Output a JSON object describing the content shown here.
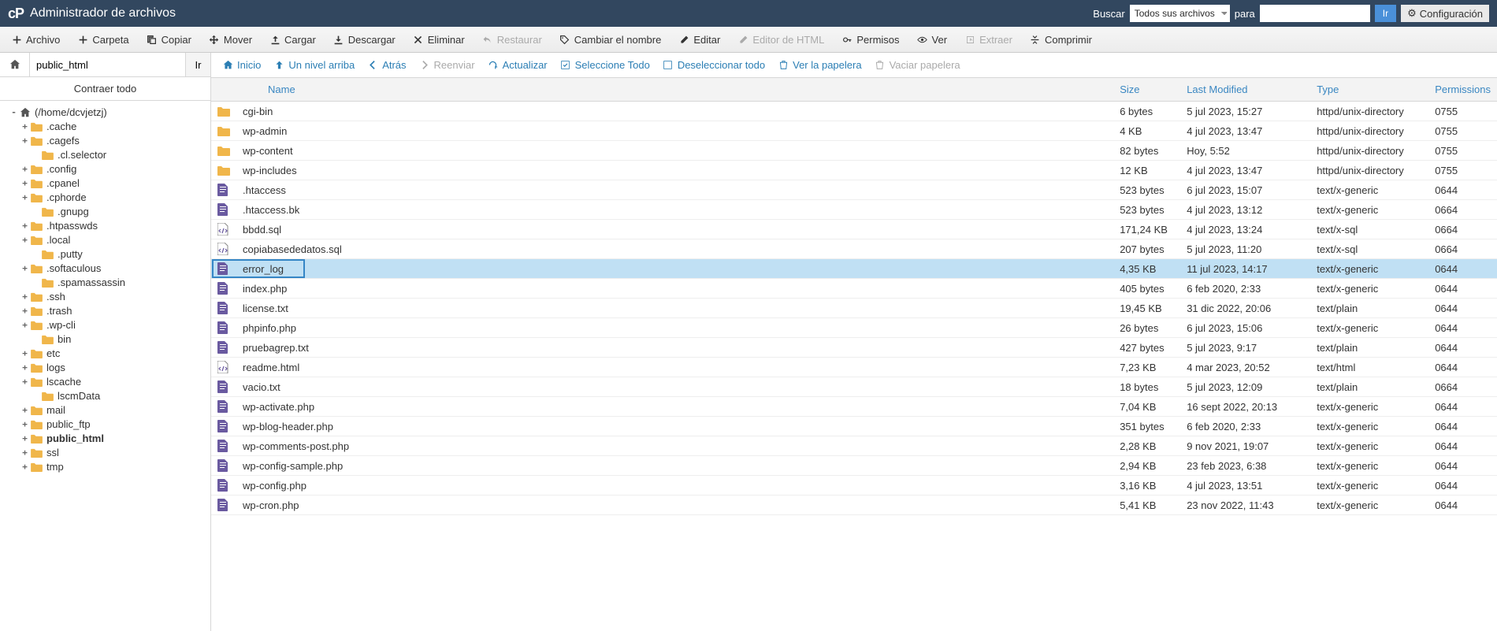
{
  "header": {
    "title": "Administrador de archivos",
    "search_label": "Buscar",
    "scope_selected": "Todos sus archivos",
    "for_label": "para",
    "search_value": "",
    "go_label": "Ir",
    "settings_label": "Configuración"
  },
  "toolbar": [
    {
      "id": "file",
      "label": "Archivo",
      "icon": "plus",
      "disabled": false
    },
    {
      "id": "folder",
      "label": "Carpeta",
      "icon": "plus",
      "disabled": false
    },
    {
      "id": "copy",
      "label": "Copiar",
      "icon": "copy",
      "disabled": false
    },
    {
      "id": "move",
      "label": "Mover",
      "icon": "move",
      "disabled": false
    },
    {
      "id": "upload",
      "label": "Cargar",
      "icon": "upload",
      "disabled": false
    },
    {
      "id": "download",
      "label": "Descargar",
      "icon": "download",
      "disabled": false
    },
    {
      "id": "delete",
      "label": "Eliminar",
      "icon": "x",
      "disabled": false
    },
    {
      "id": "restore",
      "label": "Restaurar",
      "icon": "undo",
      "disabled": true
    },
    {
      "id": "rename",
      "label": "Cambiar el nombre",
      "icon": "tag",
      "disabled": false
    },
    {
      "id": "edit",
      "label": "Editar",
      "icon": "pencil",
      "disabled": false
    },
    {
      "id": "htmleditor",
      "label": "Editor de HTML",
      "icon": "pencil",
      "disabled": true
    },
    {
      "id": "perms",
      "label": "Permisos",
      "icon": "key",
      "disabled": false
    },
    {
      "id": "view",
      "label": "Ver",
      "icon": "eye",
      "disabled": false
    },
    {
      "id": "extract",
      "label": "Extraer",
      "icon": "extract",
      "disabled": true
    },
    {
      "id": "compress",
      "label": "Comprimir",
      "icon": "compress",
      "disabled": false
    }
  ],
  "pathbar": {
    "value": "public_html",
    "go": "Ir"
  },
  "collapse_all": "Contraer todo",
  "tree": [
    {
      "depth": 0,
      "toggle": "-",
      "label": "(/home/dcvjetzj)",
      "icon": "home",
      "bold": false
    },
    {
      "depth": 1,
      "toggle": "+",
      "label": ".cache",
      "icon": "folder",
      "bold": false
    },
    {
      "depth": 1,
      "toggle": "+",
      "label": ".cagefs",
      "icon": "folder",
      "bold": false
    },
    {
      "depth": 2,
      "toggle": "",
      "label": ".cl.selector",
      "icon": "folder",
      "bold": false
    },
    {
      "depth": 1,
      "toggle": "+",
      "label": ".config",
      "icon": "folder",
      "bold": false
    },
    {
      "depth": 1,
      "toggle": "+",
      "label": ".cpanel",
      "icon": "folder",
      "bold": false
    },
    {
      "depth": 1,
      "toggle": "+",
      "label": ".cphorde",
      "icon": "folder",
      "bold": false
    },
    {
      "depth": 2,
      "toggle": "",
      "label": ".gnupg",
      "icon": "folder",
      "bold": false
    },
    {
      "depth": 1,
      "toggle": "+",
      "label": ".htpasswds",
      "icon": "folder",
      "bold": false
    },
    {
      "depth": 1,
      "toggle": "+",
      "label": ".local",
      "icon": "folder",
      "bold": false
    },
    {
      "depth": 2,
      "toggle": "",
      "label": ".putty",
      "icon": "folder",
      "bold": false
    },
    {
      "depth": 1,
      "toggle": "+",
      "label": ".softaculous",
      "icon": "folder",
      "bold": false
    },
    {
      "depth": 2,
      "toggle": "",
      "label": ".spamassassin",
      "icon": "folder",
      "bold": false
    },
    {
      "depth": 1,
      "toggle": "+",
      "label": ".ssh",
      "icon": "folder",
      "bold": false
    },
    {
      "depth": 1,
      "toggle": "+",
      "label": ".trash",
      "icon": "folder",
      "bold": false
    },
    {
      "depth": 1,
      "toggle": "+",
      "label": ".wp-cli",
      "icon": "folder",
      "bold": false
    },
    {
      "depth": 2,
      "toggle": "",
      "label": "bin",
      "icon": "folder",
      "bold": false
    },
    {
      "depth": 1,
      "toggle": "+",
      "label": "etc",
      "icon": "folder",
      "bold": false
    },
    {
      "depth": 1,
      "toggle": "+",
      "label": "logs",
      "icon": "folder",
      "bold": false
    },
    {
      "depth": 1,
      "toggle": "+",
      "label": "lscache",
      "icon": "folder",
      "bold": false
    },
    {
      "depth": 2,
      "toggle": "",
      "label": "lscmData",
      "icon": "folder",
      "bold": false
    },
    {
      "depth": 1,
      "toggle": "+",
      "label": "mail",
      "icon": "folder",
      "bold": false
    },
    {
      "depth": 1,
      "toggle": "+",
      "label": "public_ftp",
      "icon": "folder",
      "bold": false
    },
    {
      "depth": 1,
      "toggle": "+",
      "label": "public_html",
      "icon": "folder",
      "bold": true
    },
    {
      "depth": 1,
      "toggle": "+",
      "label": "ssl",
      "icon": "folder",
      "bold": false
    },
    {
      "depth": 1,
      "toggle": "+",
      "label": "tmp",
      "icon": "folder",
      "bold": false
    }
  ],
  "navbar": [
    {
      "id": "home",
      "label": "Inicio",
      "icon": "home",
      "disabled": false
    },
    {
      "id": "up",
      "label": "Un nivel arriba",
      "icon": "uparrow",
      "disabled": false
    },
    {
      "id": "back",
      "label": "Atrás",
      "icon": "left",
      "disabled": false
    },
    {
      "id": "fwd",
      "label": "Reenviar",
      "icon": "right",
      "disabled": true
    },
    {
      "id": "reload",
      "label": "Actualizar",
      "icon": "reload",
      "disabled": false
    },
    {
      "id": "selectall",
      "label": "Seleccione Todo",
      "icon": "check",
      "disabled": false
    },
    {
      "id": "deselect",
      "label": "Deseleccionar todo",
      "icon": "uncheck",
      "disabled": false
    },
    {
      "id": "trash",
      "label": "Ver la papelera",
      "icon": "trash",
      "disabled": false
    },
    {
      "id": "empty",
      "label": "Vaciar papelera",
      "icon": "trash",
      "disabled": true
    }
  ],
  "columns": {
    "name": "Name",
    "size": "Size",
    "modified": "Last Modified",
    "type": "Type",
    "perms": "Permissions"
  },
  "files": [
    {
      "icon": "folder",
      "name": "cgi-bin",
      "size": "6 bytes",
      "mod": "5 jul 2023, 15:27",
      "type": "httpd/unix-directory",
      "perm": "0755",
      "sel": false
    },
    {
      "icon": "folder",
      "name": "wp-admin",
      "size": "4 KB",
      "mod": "4 jul 2023, 13:47",
      "type": "httpd/unix-directory",
      "perm": "0755",
      "sel": false
    },
    {
      "icon": "folder",
      "name": "wp-content",
      "size": "82 bytes",
      "mod": "Hoy, 5:52",
      "type": "httpd/unix-directory",
      "perm": "0755",
      "sel": false
    },
    {
      "icon": "folder",
      "name": "wp-includes",
      "size": "12 KB",
      "mod": "4 jul 2023, 13:47",
      "type": "httpd/unix-directory",
      "perm": "0755",
      "sel": false
    },
    {
      "icon": "file",
      "name": ".htaccess",
      "size": "523 bytes",
      "mod": "6 jul 2023, 15:07",
      "type": "text/x-generic",
      "perm": "0644",
      "sel": false
    },
    {
      "icon": "file",
      "name": ".htaccess.bk",
      "size": "523 bytes",
      "mod": "4 jul 2023, 13:12",
      "type": "text/x-generic",
      "perm": "0664",
      "sel": false
    },
    {
      "icon": "code",
      "name": "bbdd.sql",
      "size": "171,24 KB",
      "mod": "4 jul 2023, 13:24",
      "type": "text/x-sql",
      "perm": "0664",
      "sel": false
    },
    {
      "icon": "code",
      "name": "copiabasededatos.sql",
      "size": "207 bytes",
      "mod": "5 jul 2023, 11:20",
      "type": "text/x-sql",
      "perm": "0664",
      "sel": false
    },
    {
      "icon": "file",
      "name": "error_log",
      "size": "4,35 KB",
      "mod": "11 jul 2023, 14:17",
      "type": "text/x-generic",
      "perm": "0644",
      "sel": true
    },
    {
      "icon": "file",
      "name": "index.php",
      "size": "405 bytes",
      "mod": "6 feb 2020, 2:33",
      "type": "text/x-generic",
      "perm": "0644",
      "sel": false
    },
    {
      "icon": "file",
      "name": "license.txt",
      "size": "19,45 KB",
      "mod": "31 dic 2022, 20:06",
      "type": "text/plain",
      "perm": "0644",
      "sel": false
    },
    {
      "icon": "file",
      "name": "phpinfo.php",
      "size": "26 bytes",
      "mod": "6 jul 2023, 15:06",
      "type": "text/x-generic",
      "perm": "0644",
      "sel": false
    },
    {
      "icon": "file",
      "name": "pruebagrep.txt",
      "size": "427 bytes",
      "mod": "5 jul 2023, 9:17",
      "type": "text/plain",
      "perm": "0644",
      "sel": false
    },
    {
      "icon": "code",
      "name": "readme.html",
      "size": "7,23 KB",
      "mod": "4 mar 2023, 20:52",
      "type": "text/html",
      "perm": "0644",
      "sel": false
    },
    {
      "icon": "file",
      "name": "vacio.txt",
      "size": "18 bytes",
      "mod": "5 jul 2023, 12:09",
      "type": "text/plain",
      "perm": "0664",
      "sel": false
    },
    {
      "icon": "file",
      "name": "wp-activate.php",
      "size": "7,04 KB",
      "mod": "16 sept 2022, 20:13",
      "type": "text/x-generic",
      "perm": "0644",
      "sel": false
    },
    {
      "icon": "file",
      "name": "wp-blog-header.php",
      "size": "351 bytes",
      "mod": "6 feb 2020, 2:33",
      "type": "text/x-generic",
      "perm": "0644",
      "sel": false
    },
    {
      "icon": "file",
      "name": "wp-comments-post.php",
      "size": "2,28 KB",
      "mod": "9 nov 2021, 19:07",
      "type": "text/x-generic",
      "perm": "0644",
      "sel": false
    },
    {
      "icon": "file",
      "name": "wp-config-sample.php",
      "size": "2,94 KB",
      "mod": "23 feb 2023, 6:38",
      "type": "text/x-generic",
      "perm": "0644",
      "sel": false
    },
    {
      "icon": "file",
      "name": "wp-config.php",
      "size": "3,16 KB",
      "mod": "4 jul 2023, 13:51",
      "type": "text/x-generic",
      "perm": "0644",
      "sel": false
    },
    {
      "icon": "file",
      "name": "wp-cron.php",
      "size": "5,41 KB",
      "mod": "23 nov 2022, 11:43",
      "type": "text/x-generic",
      "perm": "0644",
      "sel": false
    }
  ]
}
